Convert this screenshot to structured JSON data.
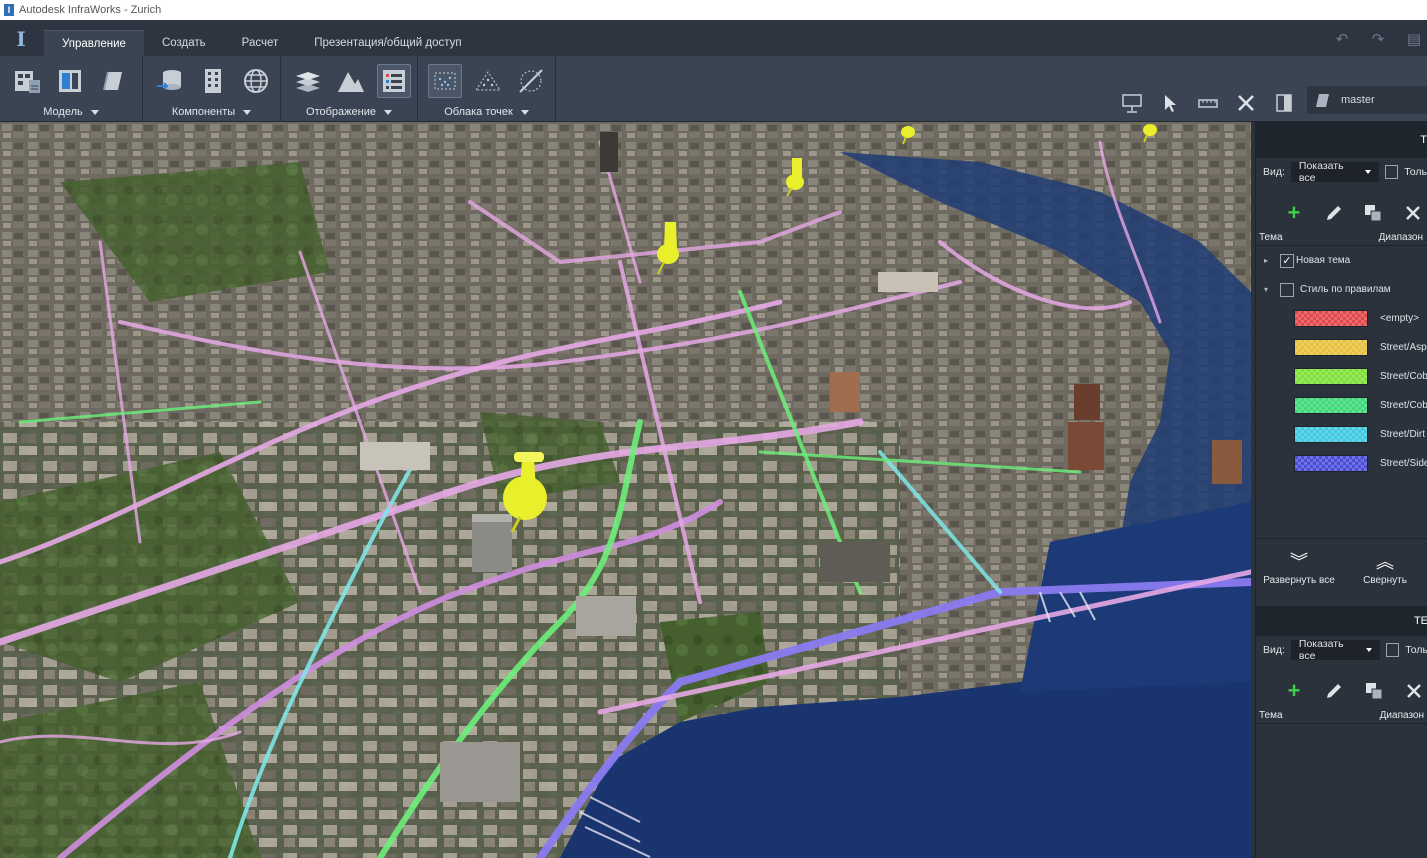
{
  "window": {
    "title": "Autodesk InfraWorks - Zurich"
  },
  "tabs": [
    {
      "label": "Управление",
      "active": true
    },
    {
      "label": "Создать",
      "active": false
    },
    {
      "label": "Расчет",
      "active": false
    },
    {
      "label": "Презентация/общий доступ",
      "active": false
    }
  ],
  "ribbon": {
    "groups": [
      {
        "label": "Модель"
      },
      {
        "label": "Компоненты"
      },
      {
        "label": "Отображение"
      },
      {
        "label": "Облака точек"
      }
    ],
    "branch": "master"
  },
  "panel": {
    "top_title": "Т",
    "view_label": "Вид:",
    "view_select": "Показать все",
    "only_label": "Толь",
    "col_theme": "Тема",
    "col_range": "Диапазон",
    "tree": [
      {
        "label": "Новая тема",
        "checked": true,
        "arrow": "▸"
      },
      {
        "label": "Стиль по правилам",
        "checked": false,
        "arrow": "▾"
      }
    ],
    "legend": [
      {
        "label": "<empty>",
        "color": "#e0484c"
      },
      {
        "label": "Street/Asp",
        "color": "#e7c23e"
      },
      {
        "label": "Street/Cob",
        "color": "#7fe03a"
      },
      {
        "label": "Street/Cob",
        "color": "#3fd97a"
      },
      {
        "label": "Street/Dirt",
        "color": "#3fc8e0"
      },
      {
        "label": "Street/Side",
        "color": "#4a4ed6"
      }
    ],
    "expand_all": "Развернуть все",
    "collapse_all": "Свернуть",
    "bottom_title": "TE",
    "view_label2": "Вид:",
    "view_select2": "Показать все",
    "only_label2": "Толь",
    "col_theme2": "Тема",
    "col_range2": "Диапазон"
  }
}
